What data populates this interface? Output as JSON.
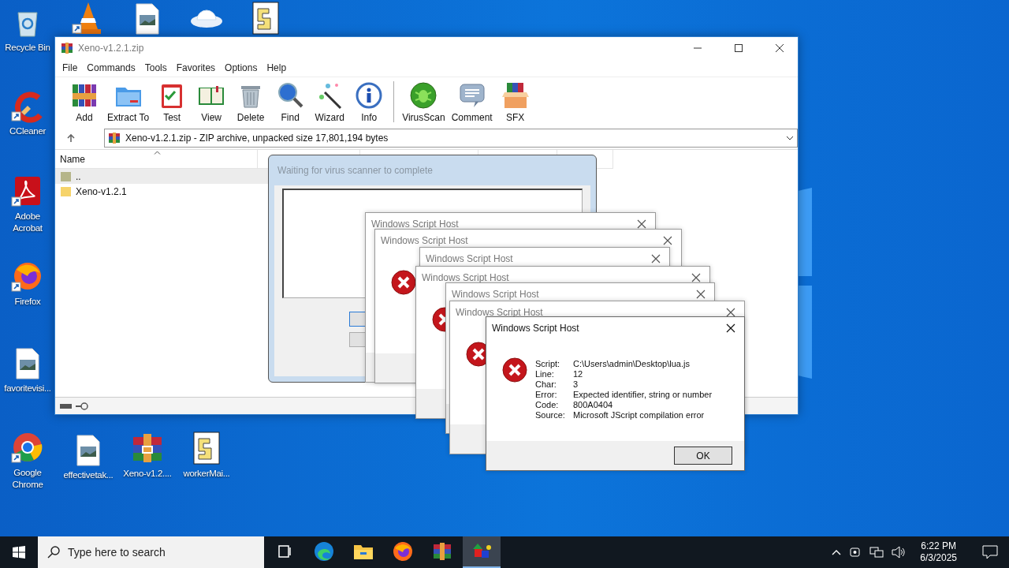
{
  "desktop_icons": [
    {
      "label": "Recycle Bin",
      "kind": "recycle",
      "shortcut": false
    },
    {
      "label": "CCleaner",
      "kind": "ccleaner",
      "shortcut": true
    },
    {
      "label": "Adobe Acrobat",
      "kind": "pdf",
      "shortcut": true
    },
    {
      "label": "Firefox",
      "kind": "firefox",
      "shortcut": true
    },
    {
      "label": "favoritevisi...",
      "kind": "image",
      "shortcut": false
    },
    {
      "label": "Google Chrome",
      "kind": "chrome",
      "shortcut": true
    },
    {
      "kind": "vlc",
      "shortcut": true
    },
    {
      "kind": "image",
      "shortcut": false
    },
    {
      "kind": "ufo",
      "shortcut": false
    },
    {
      "kind": "script",
      "shortcut": false
    },
    {
      "label": "effectivetak...",
      "kind": "image",
      "shortcut": false
    },
    {
      "label": "Xeno-v1.2....",
      "kind": "archive",
      "shortcut": false
    },
    {
      "label": "workerMai...",
      "kind": "script",
      "shortcut": false
    }
  ],
  "winrar": {
    "title": "Xeno-v1.2.1.zip",
    "menu": [
      "File",
      "Commands",
      "Tools",
      "Favorites",
      "Options",
      "Help"
    ],
    "toolbar": [
      {
        "label": "Add",
        "kind": "add",
        "separated": false
      },
      {
        "label": "Extract To",
        "kind": "extract",
        "separated": false
      },
      {
        "label": "Test",
        "kind": "test",
        "separated": false
      },
      {
        "label": "View",
        "kind": "view",
        "separated": false
      },
      {
        "label": "Delete",
        "kind": "delete",
        "separated": false
      },
      {
        "label": "Find",
        "kind": "find",
        "separated": false
      },
      {
        "label": "Wizard",
        "kind": "wizard",
        "separated": false
      },
      {
        "label": "Info",
        "kind": "info",
        "separated": false
      },
      {
        "label": "VirusScan",
        "kind": "virusscan",
        "separated": true
      },
      {
        "label": "Comment",
        "kind": "comment",
        "separated": false
      },
      {
        "label": "SFX",
        "kind": "sfx",
        "separated": false
      }
    ],
    "address": "Xeno-v1.2.1.zip - ZIP archive, unpacked size 17,801,194 bytes",
    "columns": [
      "Name"
    ],
    "rows": [
      {
        "name": "..",
        "kind": "up",
        "selected": true
      },
      {
        "name": "Xeno-v1.2.1",
        "kind": "folder",
        "selected": false
      }
    ]
  },
  "scan_dialog": {
    "title": "Waiting for virus scanner to complete"
  },
  "script_dialogs": [
    {
      "title": "Windows Script Host",
      "active": false
    },
    {
      "title": "Windows Script Host",
      "active": false
    },
    {
      "title": "Windows Script Host",
      "active": false
    },
    {
      "title": "Windows Script Host",
      "active": false
    },
    {
      "title": "Windows Script Host",
      "active": false
    },
    {
      "title": "Windows Script Host",
      "active": false
    },
    {
      "title": "Windows Script Host",
      "active": true,
      "fields": [
        {
          "label": "Script:",
          "value": "C:\\Users\\admin\\Desktop\\lua.js"
        },
        {
          "label": "Line:",
          "value": "12"
        },
        {
          "label": "Char:",
          "value": "3"
        },
        {
          "label": "Error:",
          "value": "Expected identifier, string or number"
        },
        {
          "label": "Code:",
          "value": "800A0404"
        },
        {
          "label": "Source:",
          "value": "Microsoft JScript compilation error"
        }
      ],
      "button": "OK"
    }
  ],
  "taskbar": {
    "search_placeholder": "Type here to search",
    "apps": [
      {
        "kind": "taskview",
        "selected": false
      },
      {
        "kind": "edge",
        "selected": false
      },
      {
        "kind": "explorer",
        "selected": false
      },
      {
        "kind": "firefox",
        "selected": false
      },
      {
        "kind": "winrar",
        "selected": false
      },
      {
        "kind": "shapes",
        "selected": true
      }
    ],
    "time": "6:22 PM",
    "date": "6/3/2025"
  }
}
